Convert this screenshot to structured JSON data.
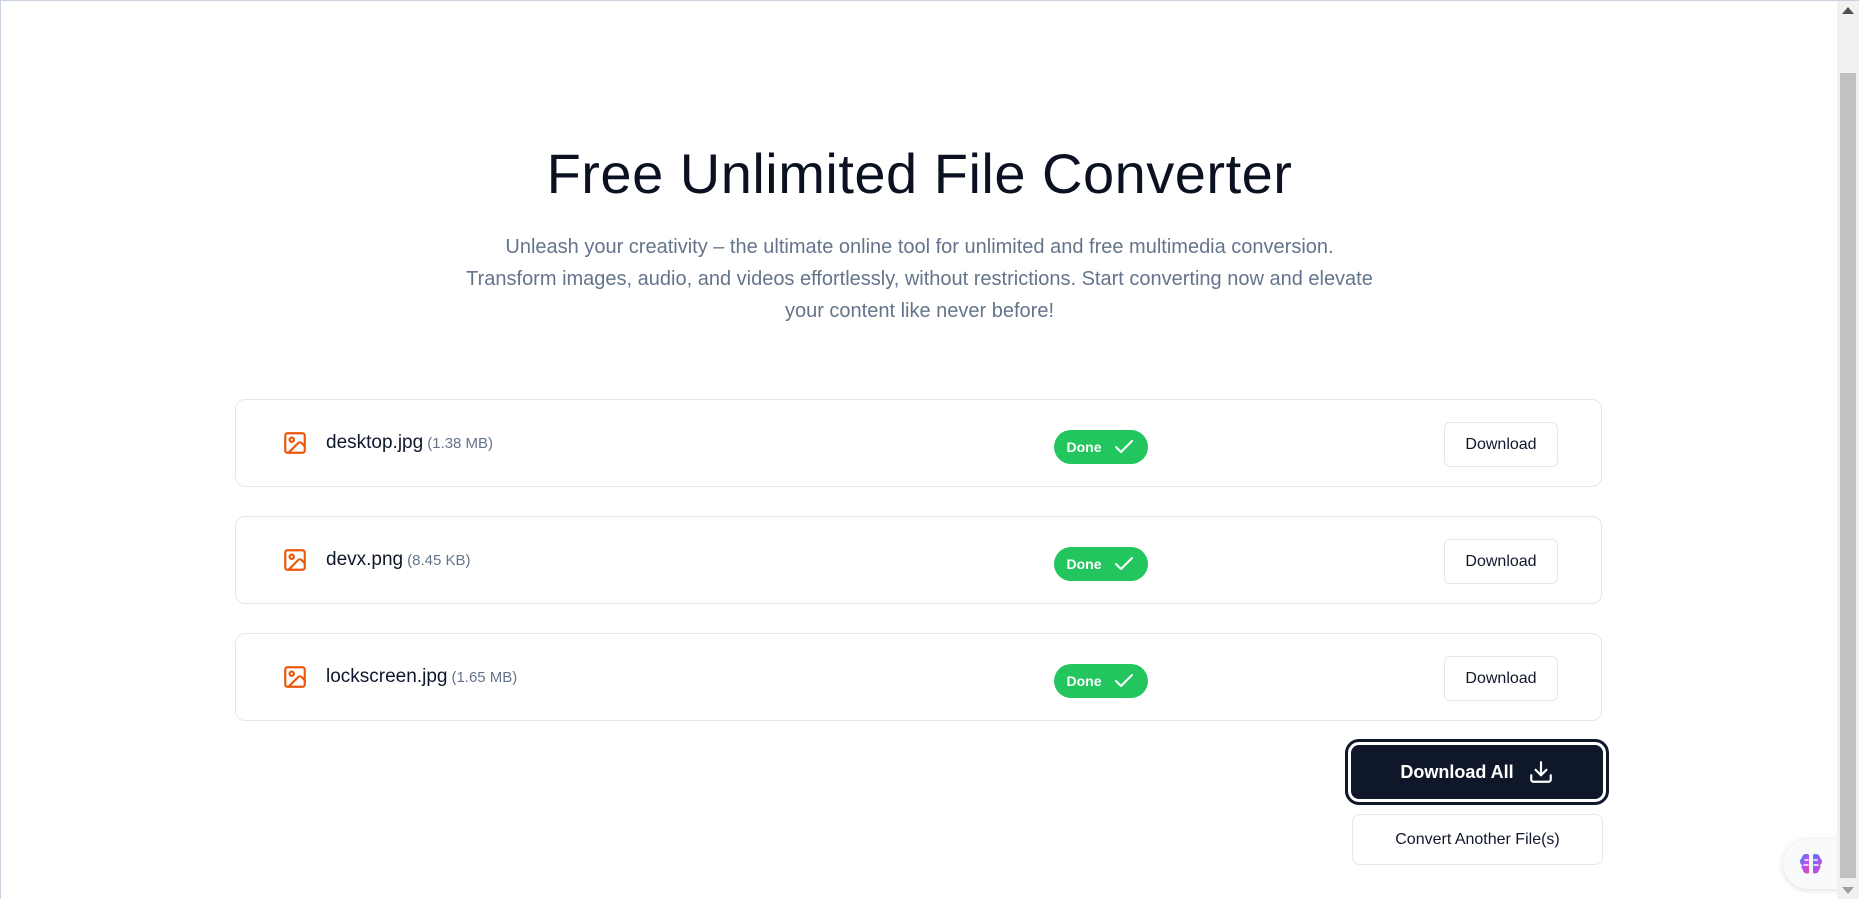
{
  "page": {
    "title": "Free Unlimited File Converter",
    "subtitle": "Unleash your creativity – the ultimate online tool for unlimited and free multimedia conversion. Transform images, audio, and videos effortlessly, without restrictions. Start converting now and elevate your content like never before!"
  },
  "files": [
    {
      "name": "desktop.jpg",
      "size": "(1.38 MB)",
      "status": "Done",
      "download_label": "Download"
    },
    {
      "name": "devx.png",
      "size": "(8.45 KB)",
      "status": "Done",
      "download_label": "Download"
    },
    {
      "name": "lockscreen.jpg",
      "size": "(1.65 MB)",
      "status": "Done",
      "download_label": "Download"
    }
  ],
  "actions": {
    "download_all_label": "Download All",
    "convert_another_label": "Convert Another File(s)"
  },
  "colors": {
    "accent_orange": "#ea580c",
    "done_green": "#22c55e",
    "primary_dark": "#0f172a"
  },
  "icons": {
    "file_type": "image-file-icon",
    "done": "checkmark-icon",
    "download_all": "download-icon",
    "assistant": "brain-icon"
  }
}
